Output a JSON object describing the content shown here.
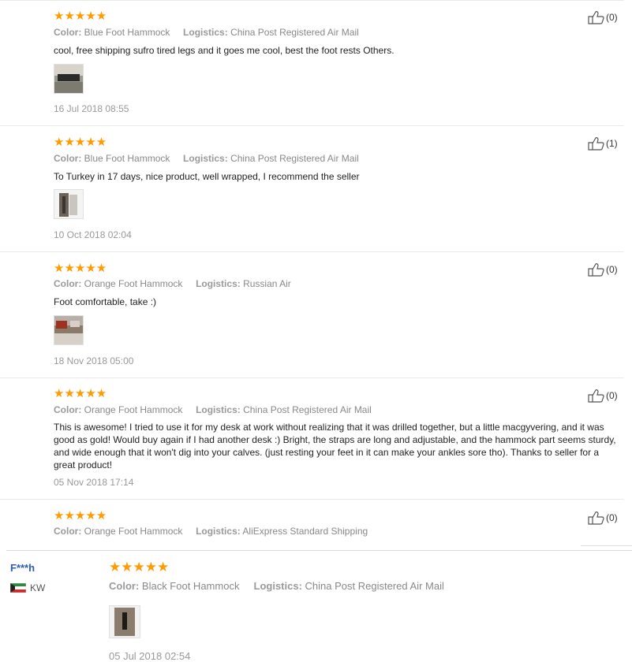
{
  "stars_glyph": "★★★★★",
  "labels": {
    "color": "Color:",
    "logistics": "Logistics:"
  },
  "reviews": [
    {
      "color": "Blue Foot Hammock",
      "logistics": "China Post Registered Air Mail",
      "text": "cool, free shipping sufro tired legs and it goes me cool, best the foot rests Others.",
      "date": "16 Jul 2018 08:55",
      "helpful": "(0)"
    },
    {
      "color": "Blue Foot Hammock",
      "logistics": "China Post Registered Air Mail",
      "text": "To Turkey in 17 days, nice product, well wrapped, I recommend the seller",
      "date": "10 Oct 2018 02:04",
      "helpful": "(1)"
    },
    {
      "color": "Orange Foot Hammock",
      "logistics": "Russian Air",
      "text": "Foot comfortable, take :)",
      "date": "18 Nov 2018 05:00",
      "helpful": "(0)"
    },
    {
      "color": "Orange Foot Hammock",
      "logistics": "China Post Registered Air Mail",
      "text": "This is awesome! I tried to use it for my desk at work without realizing that it was drilled together, but a little macgyvering, and it was good as gold! Would buy again if I had another desk :) Bright, the straps are long and adjustable, and the hammock part seems sturdy, and wide enough that it won't dig into your calves. (just resting your feet in it can make your ankles sore tho). Thanks to seller for a great product!",
      "date": "05 Nov 2018 17:14",
      "helpful": "(0)"
    },
    {
      "color": "Orange Foot Hammock",
      "logistics": "AliExpress Standard Shipping",
      "helpful": "(0)"
    },
    {
      "user": "F***h",
      "country": "KW",
      "color": "Black Foot Hammock",
      "logistics": "China Post Registered Air Mail",
      "date": "05 Jul 2018 02:54"
    }
  ],
  "colors": {
    "star": "#ff9a00",
    "username": "#2a5db0"
  },
  "icons": {
    "helpful": "thumbs-up-icon",
    "flag": "kuwait-flag-icon"
  }
}
